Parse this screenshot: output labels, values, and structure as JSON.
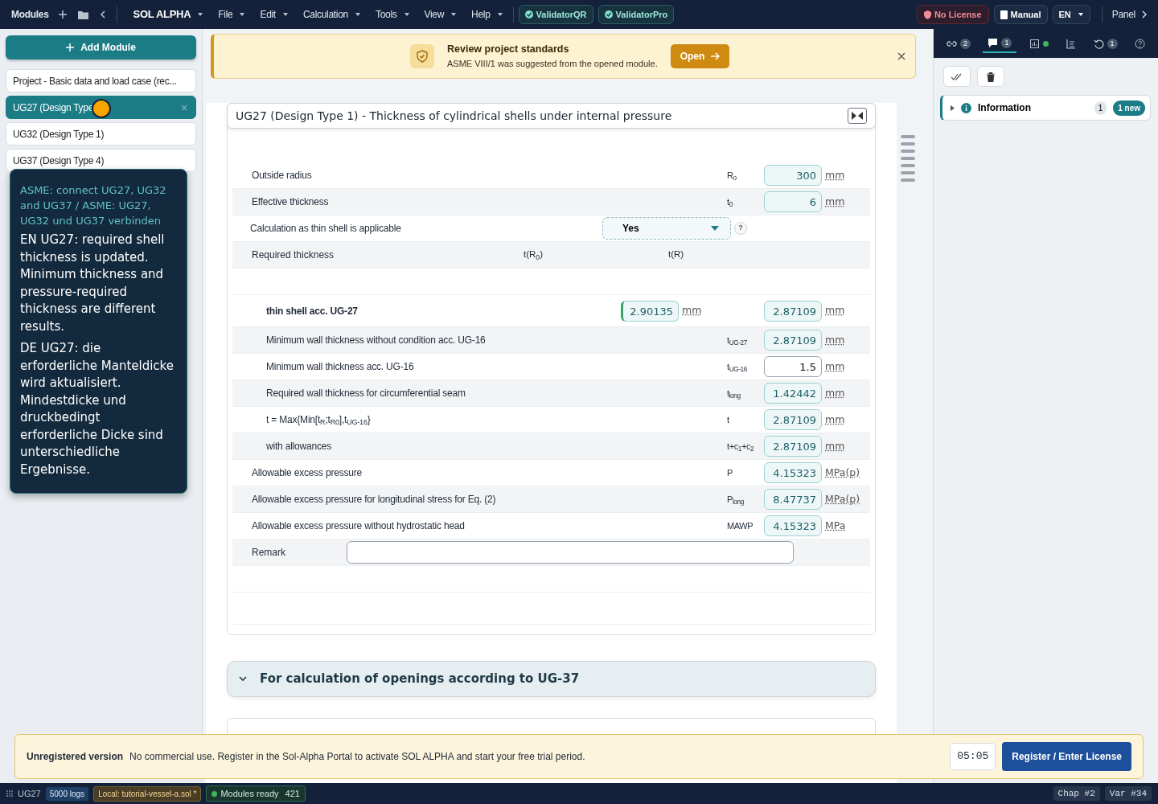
{
  "menubar": {
    "modules_label": "Modules",
    "app_name": "SOL ALPHA",
    "menus": [
      "File",
      "Edit",
      "Calculation",
      "Tools",
      "View",
      "Help"
    ],
    "validators": [
      "ValidatorQR",
      "ValidatorPro"
    ],
    "license": "No License",
    "manual": "Manual",
    "language": "EN",
    "panel": "Panel"
  },
  "sidebar": {
    "add_button": "Add Module",
    "modules": [
      {
        "label": "Project - Basic data and load case (rec...",
        "selected": false
      },
      {
        "label": "UG27 (Design Type",
        "selected": true
      },
      {
        "label": "UG32 (Design Type 1)",
        "selected": false
      },
      {
        "label": "UG37 (Design Type 4)",
        "selected": false
      }
    ],
    "tooltip": {
      "title": "ASME: connect UG27, UG32 and UG37 / ASME: UG27, UG32 und UG37 verbinden",
      "paragraphs": [
        "EN UG27: required shell thickness is updated. Minimum thickness and pressure-required thickness are different results.",
        "DE UG27: die erforderliche Manteldicke wird aktualisiert. Mindestdicke und druckbedingt erforderliche Dicke sind unterschiedliche Ergebnisse."
      ]
    }
  },
  "notice": {
    "title": "Review project standards",
    "text": "ASME VIII/1 was suggested from the opened module.",
    "button": "Open"
  },
  "section": {
    "title": "UG27 (Design Type 1) - Thickness of cylindrical shells under internal pressure",
    "rows": [
      {
        "kind": "value",
        "label": "Outside radius",
        "symbol": "R$_{o}$",
        "value": "300",
        "unit": "mm",
        "editable": false
      },
      {
        "kind": "value",
        "label": "Effective thickness",
        "symbol": "t$_{0}$",
        "value": "6",
        "unit": "mm",
        "editable": false
      },
      {
        "kind": "select",
        "label": "Calculation as thin shell is applicable",
        "value": "Yes",
        "help": "?"
      },
      {
        "kind": "header",
        "label": "Required thickness",
        "col1": "t(R$_{0}$)",
        "col2": "t(R)",
        "children": [
          {
            "kind": "dual",
            "label": "thin shell acc. UG-27",
            "value1": "2.90135",
            "unit1": "mm",
            "value": "2.87109",
            "unit": "mm",
            "editable": false
          },
          {
            "kind": "value",
            "label": "Minimum wall thickness without condition acc. UG-16",
            "symbol": "t$_{UG-27}$",
            "value": "2.87109",
            "unit": "mm",
            "editable": false
          },
          {
            "kind": "value",
            "label": "Minimum wall thickness acc. UG-16",
            "symbol": "t$_{UG-16}$",
            "value": "1.5",
            "unit": "mm",
            "editable": true
          },
          {
            "kind": "value",
            "label": "Required wall thickness for circumferential seam",
            "symbol": "t$_{long}$",
            "value": "1.42442",
            "unit": "mm",
            "editable": false
          },
          {
            "kind": "value",
            "label": "t = Max{Min[t$_{R}$;t$_{R0}$],t$_{UG-16}$}",
            "symbol": "t",
            "value": "2.87109",
            "unit": "mm",
            "editable": false
          },
          {
            "kind": "value",
            "label": "with allowances",
            "symbol": "t+c$_{1}$+c$_{2}$",
            "value": "2.87109",
            "unit": "mm",
            "editable": false
          }
        ]
      },
      {
        "kind": "value",
        "label": "Allowable excess pressure",
        "symbol": "P",
        "value": "4.15323",
        "unit": "MPa(p)",
        "editable": false
      },
      {
        "kind": "value",
        "label": "Allowable excess pressure for longitudinal stress for Eq. (2)",
        "symbol": "P$_{long}$",
        "value": "8.47737",
        "unit": "MPa(p)",
        "editable": false
      },
      {
        "kind": "value",
        "label": "Allowable excess pressure without hydrostatic head",
        "symbol": "MAWP",
        "value": "4.15323",
        "unit": "MPa",
        "editable": false
      },
      {
        "kind": "remark",
        "label": "Remark"
      }
    ]
  },
  "collapsed_section": {
    "title": "For calculation of openings according to UG-37",
    "expanded": false
  },
  "right_panel": {
    "tabs": [
      {
        "badge": "2",
        "selected": false
      },
      {
        "badge": "1",
        "selected": true
      },
      {
        "dot": true,
        "selected": false
      },
      {
        "selected": false
      },
      {
        "badge": "1",
        "selected": false
      },
      {
        "selected": false
      }
    ],
    "groups": [
      {
        "label": "Information",
        "count": "1",
        "new": "1 new",
        "expanded": false
      }
    ]
  },
  "banner": {
    "title": "Unregistered version",
    "text": "No commercial use. Register in the Sol-Alpha Portal to activate SOL ALPHA and start your free trial period.",
    "timer": "05:05",
    "button": "Register / Enter License"
  },
  "status_bar": {
    "module": "UG27",
    "logs": "5000 logs",
    "file": "Local: tutorial-vessel-a.sol *",
    "ready": "Modules ready",
    "ready_count": "421",
    "chapter": "Chap #2",
    "variable": "Var #34"
  }
}
